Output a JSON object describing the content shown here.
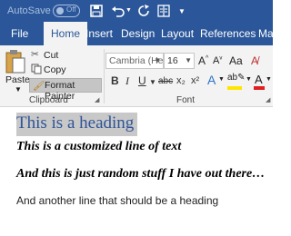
{
  "quick_access": {
    "autosave_label": "AutoSave",
    "autosave_state": "Off",
    "icons": [
      "save-icon",
      "undo-icon",
      "redo-icon",
      "touch-mode-icon"
    ]
  },
  "ribbon_tabs": [
    {
      "label": "File"
    },
    {
      "label": "Home",
      "active": true
    },
    {
      "label": "Insert"
    },
    {
      "label": "Design"
    },
    {
      "label": "Layout"
    },
    {
      "label": "References"
    },
    {
      "label": "Maili"
    }
  ],
  "clipboard": {
    "paste": "Paste",
    "cut": "Cut",
    "copy": "Copy",
    "format_painter": "Format Painter",
    "group_label": "Clipboard"
  },
  "font": {
    "name": "Cambria (Hea",
    "size": "16",
    "bold": "B",
    "italic": "I",
    "underline": "U",
    "strike": "abc",
    "subscript": "x₂",
    "superscript": "x²",
    "group_label": "Font"
  },
  "document": {
    "heading": "This is a heading",
    "line_custom": "This is a customized line of text",
    "line_random": "And this is just random stuff I have out there…",
    "line_another": "And another line that should be a heading"
  },
  "colors": {
    "title_bar": "#2b579a",
    "ribbon": "#f3f3f3",
    "heading_text": "#2f5496",
    "selection": "#c8c8c8",
    "font_color_bar": "#e02020",
    "highlight_bar": "#ffe600"
  }
}
